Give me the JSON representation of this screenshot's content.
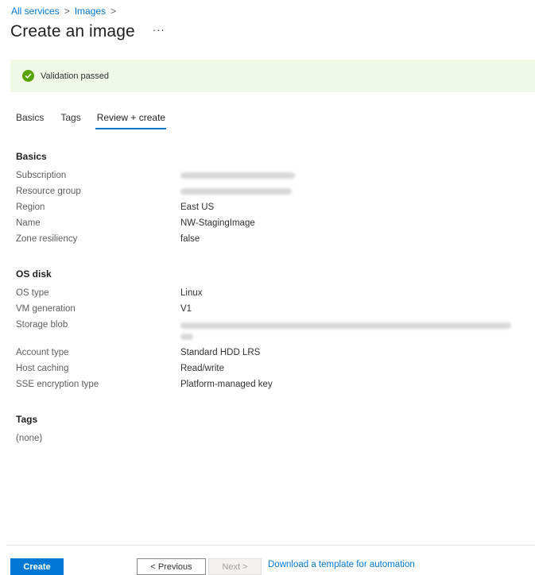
{
  "breadcrumb": {
    "items": [
      "All services",
      "Images"
    ],
    "separator": ">"
  },
  "header": {
    "title": "Create an image",
    "more_label": "···"
  },
  "validation": {
    "text": "Validation passed",
    "icon": "check-circle-icon",
    "status_color": "#57a300"
  },
  "tabs": [
    {
      "label": "Basics",
      "active": false
    },
    {
      "label": "Tags",
      "active": false
    },
    {
      "label": "Review + create",
      "active": true
    }
  ],
  "sections": {
    "basics": {
      "title": "Basics",
      "rows": [
        {
          "label": "Subscription",
          "value": ""
        },
        {
          "label": "Resource group",
          "value": ""
        },
        {
          "label": "Region",
          "value": "East US"
        },
        {
          "label": "Name",
          "value": "NW-StagingImage"
        },
        {
          "label": "Zone resiliency",
          "value": "false"
        }
      ]
    },
    "os_disk": {
      "title": "OS disk",
      "rows": [
        {
          "label": "OS type",
          "value": "Linux"
        },
        {
          "label": "VM generation",
          "value": "V1"
        },
        {
          "label": "Storage blob",
          "value": ""
        },
        {
          "label": "Account type",
          "value": "Standard HDD LRS"
        },
        {
          "label": "Host caching",
          "value": "Read/write"
        },
        {
          "label": "SSE encryption type",
          "value": "Platform-managed key"
        }
      ]
    },
    "tags": {
      "title": "Tags",
      "value": "(none)"
    }
  },
  "footer": {
    "create_label": "Create",
    "previous_label": "< Previous",
    "next_label": "Next >",
    "download_label": "Download a template for automation"
  },
  "colors": {
    "accent": "#0078d4",
    "banner_bg": "#f0f8e8"
  }
}
